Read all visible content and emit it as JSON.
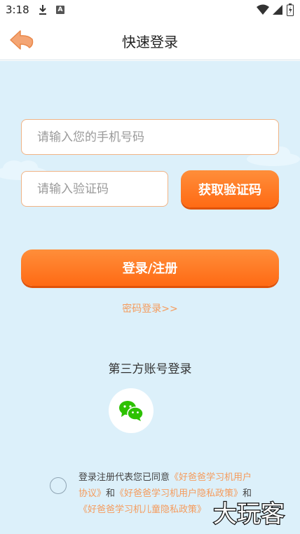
{
  "status_bar": {
    "time": "3:18",
    "icons": [
      "download-icon",
      "a-notification-icon",
      "wifi-icon",
      "signal-icon",
      "battery-icon"
    ],
    "a_label": "A"
  },
  "nav": {
    "title": "快速登录",
    "back_icon": "back-arrow-icon"
  },
  "form": {
    "phone_placeholder": "请输入您的手机号码",
    "code_placeholder": "请输入验证码",
    "get_code_label": "获取验证码",
    "login_label": "登录/注册",
    "password_login_link": "密码登录>>"
  },
  "third_party": {
    "title": "第三方账号登录",
    "wechat_icon": "wechat-icon"
  },
  "agreement": {
    "prefix": "登录注册代表您已同意",
    "user_agreement": "《好爸爸学习机用户协议》",
    "and1": "和",
    "privacy_policy": "《好爸爸学习机用户隐私政策》",
    "and2": "和",
    "child_privacy": "《好爸爸学习机儿童隐私政策》"
  },
  "watermark": {
    "text": "大玩客"
  },
  "colors": {
    "accent": "#ff7a22",
    "link": "#f59b5c",
    "background": "#dcf0fa",
    "input_border": "#f0b385"
  }
}
